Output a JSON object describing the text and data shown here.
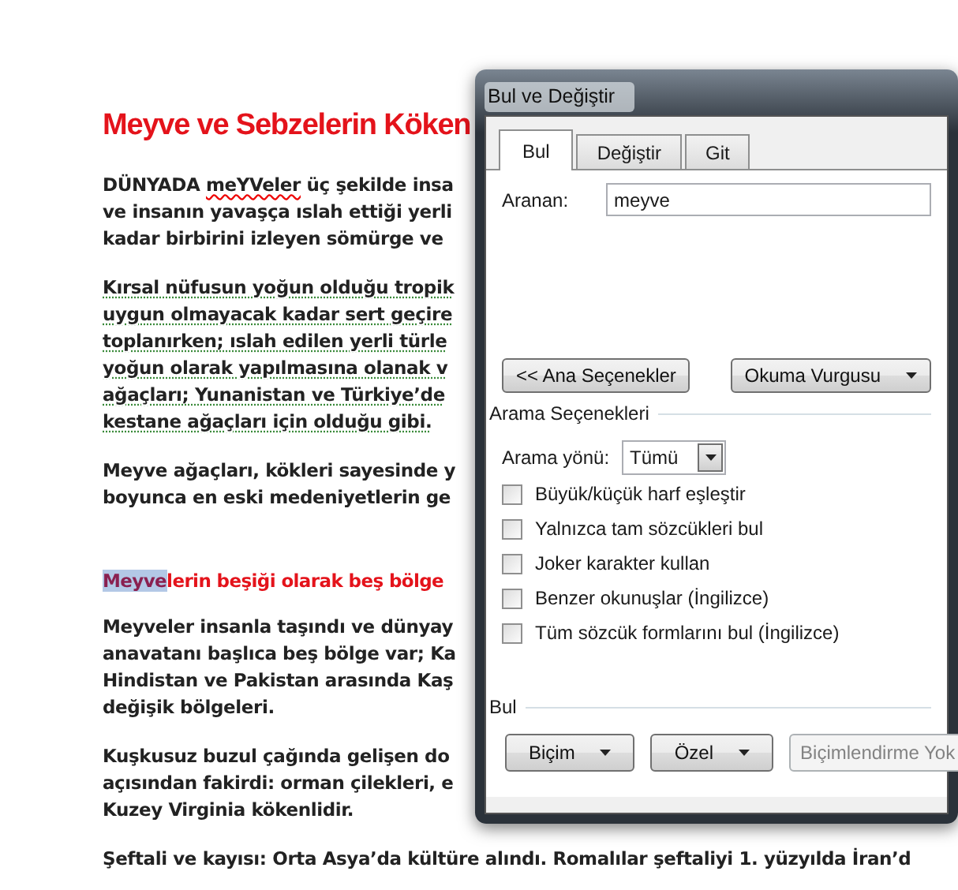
{
  "document": {
    "title": "Meyve ve Sebzelerin Köken",
    "blocks": [
      {
        "kind": "paragraph",
        "lines": [
          [
            "DÜNYADA ",
            {
              "text": "meYVeler",
              "spelling_error": true
            },
            " üç şekilde insa"
          ],
          [
            "ve insanın yavaşça ıslah ettiği yerli"
          ],
          [
            "kadar birbirini izleyen sömürge ve"
          ]
        ]
      },
      {
        "kind": "paragraph",
        "grammar_error": true,
        "lines": [
          [
            "Kırsal nüfusun yoğun olduğu tropik"
          ],
          [
            "uygun olmayacak kadar sert geçire"
          ],
          [
            "toplanırken; ıslah edilen yerli türle"
          ],
          [
            "yoğun olarak yapılmasına olanak v"
          ],
          [
            "ağaçları; Yunanistan ve Türkiye’de"
          ],
          [
            "kestane ağaçları için olduğu gibi."
          ]
        ]
      },
      {
        "kind": "paragraph",
        "lines": [
          [
            "Meyve ağaçları, kökleri sayesinde y"
          ],
          [
            "boyunca en eski medeniyetlerin ge"
          ]
        ]
      },
      {
        "kind": "heading",
        "highlight": "Meyve",
        "rest": "lerin beşiği olarak beş bölge"
      },
      {
        "kind": "paragraph",
        "lines": [
          [
            "Meyveler insanla taşındı ve dünyay"
          ],
          [
            "anavatanı başlıca beş bölge var; Ka"
          ],
          [
            "Hindistan ve Pakistan arasında Kaş"
          ],
          [
            "değişik bölgeleri."
          ]
        ]
      },
      {
        "kind": "paragraph",
        "lines": [
          [
            "Kuşkusuz buzul çağında gelişen do"
          ],
          [
            "açısından fakirdi: orman çilekleri, e"
          ],
          [
            "Kuzey Virginia kökenlidir."
          ]
        ]
      },
      {
        "kind": "paragraph",
        "lines": [
          [
            "Şeftali ve kayısı: Orta Asya’da kültüre alındı. Romalılar şeftaliyi 1. yüzyılda İran’d"
          ]
        ]
      }
    ]
  },
  "dialog": {
    "title": "Bul ve Değiştir",
    "tabs": [
      {
        "label": "Bul",
        "selected": true
      },
      {
        "label": "Değiştir",
        "selected": false
      },
      {
        "label": "Git",
        "selected": false
      }
    ],
    "find_label": "Aranan:",
    "find_value": "meyve",
    "less_button": "<< Ana Seçenekler",
    "highlight_button": "Okuma Vurgusu",
    "options_title": "Arama Seçenekleri",
    "direction_label": "Arama yönü:",
    "direction_value": "Tümü",
    "options": [
      {
        "label": "Büyük/küçük harf eşleştir",
        "checked": false
      },
      {
        "label": "Yalnızca tam sözcükleri bul",
        "checked": false
      },
      {
        "label": "Joker karakter kullan",
        "checked": false
      },
      {
        "label": "Benzer okunuşlar (İngilizce)",
        "checked": false
      },
      {
        "label": "Tüm sözcük formlarını bul (İngilizce)",
        "checked": false
      }
    ],
    "find_group_title": "Bul",
    "format_buttons": [
      {
        "label": "Biçim",
        "dropdown": true,
        "disabled": false
      },
      {
        "label": "Özel",
        "dropdown": true,
        "disabled": false
      },
      {
        "label": "Biçimlendirme Yok",
        "dropdown": false,
        "disabled": true
      }
    ]
  }
}
